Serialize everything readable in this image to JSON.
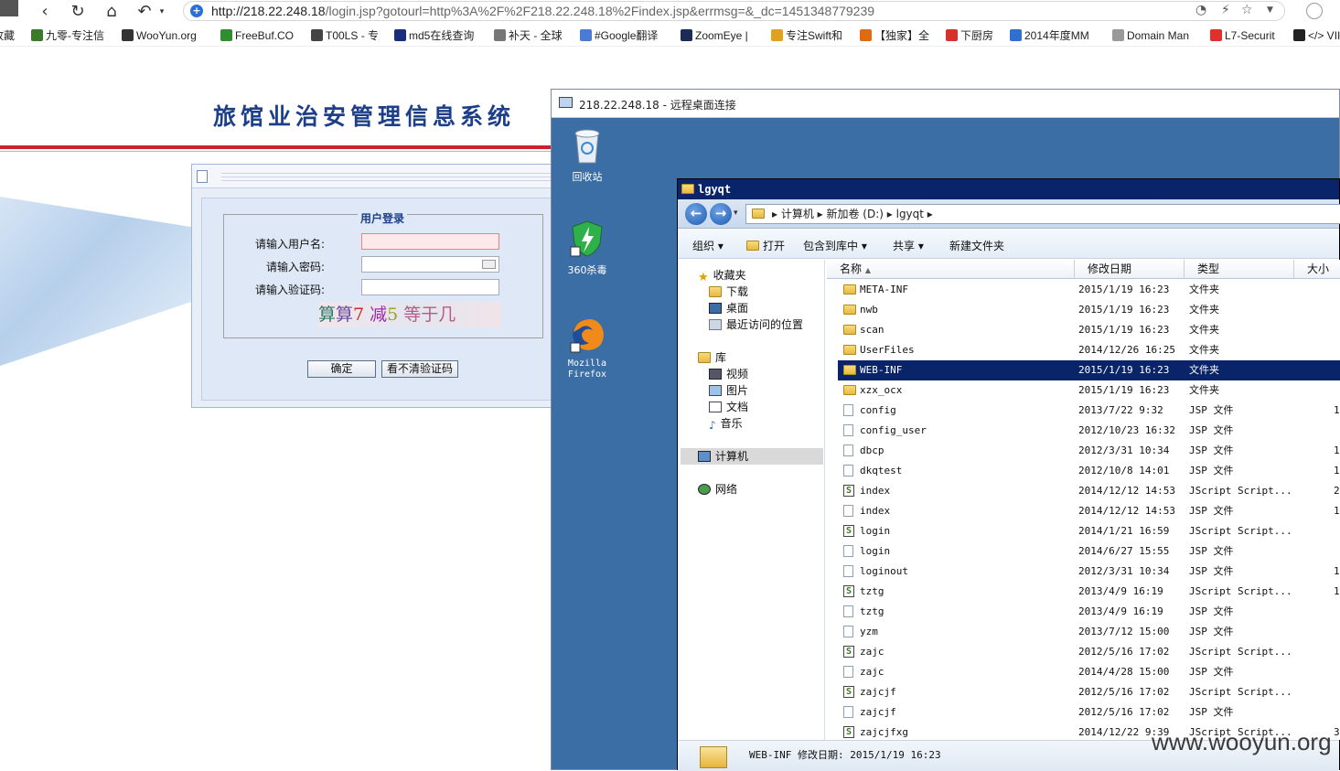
{
  "browser": {
    "url_host": "http://218.22.248.18",
    "url_path": "/login.jsp?gotourl=http%3A%2F%2F218.22.248.18%2Findex.jsp&errmsg=&_dc=1451348779239",
    "back_icon": "arrow-left-icon",
    "bookmarks": [
      {
        "label": "收藏",
        "color": "#888888"
      },
      {
        "label": "九零-专注信",
        "color": "#3c7a2a"
      },
      {
        "label": "WooYun.org",
        "color": "#333333"
      },
      {
        "label": "FreeBuf.CO",
        "color": "#2f8f2f"
      },
      {
        "label": "T00LS - 专",
        "color": "#444444"
      },
      {
        "label": "md5在线查询",
        "color": "#1a2d7a"
      },
      {
        "label": "补天 - 全球",
        "color": "#777777"
      },
      {
        "label": "#Google翻译",
        "color": "#4a7bd6"
      },
      {
        "label": "ZoomEye |",
        "color": "#1b2a57"
      },
      {
        "label": "专注Swift和",
        "color": "#e0a020"
      },
      {
        "label": "【独家】全",
        "color": "#e06a10"
      },
      {
        "label": "下厨房",
        "color": "#d6312b"
      },
      {
        "label": "2014年度MM",
        "color": "#2f6fd0"
      },
      {
        "label": "Domain Man",
        "color": "#999999"
      },
      {
        "label": "L7-Securit",
        "color": "#e0302a"
      },
      {
        "label": "</> VIIV P",
        "color": "#222222"
      }
    ]
  },
  "webpage": {
    "system_title": "旅馆业治安管理信息系统",
    "login": {
      "legend": "用户登录",
      "username_label": "请输入用户名:",
      "password_label": "请输入密码:",
      "captcha_label": "请输入验证码:",
      "captcha_parts": [
        "算",
        "算",
        "7",
        " 减",
        "5",
        " 等于几"
      ],
      "ok_button": "确定",
      "refresh_captcha_button": "看不清验证码"
    }
  },
  "rdp": {
    "title": "218.22.248.18 - 远程桌面连接",
    "desktop_icons": [
      {
        "label": "回收站",
        "icon": "recycle-bin-icon"
      },
      {
        "label": "360杀毒",
        "icon": "antivirus-shield-icon"
      },
      {
        "label": "Mozilla Firefox",
        "icon": "firefox-icon"
      }
    ],
    "explorer": {
      "title": "lgyqt",
      "breadcrumb": "▸ 计算机 ▸ 新加卷 (D:) ▸ lgyqt ▸",
      "toolbar": {
        "organize": "组织",
        "open": "打开",
        "include_in_library": "包含到库中",
        "share": "共享",
        "new_folder": "新建文件夹"
      },
      "nav": {
        "favorites": "收藏夹",
        "downloads": "下载",
        "desktop": "桌面",
        "recent": "最近访问的位置",
        "libraries": "库",
        "videos": "视频",
        "pictures": "图片",
        "documents": "文档",
        "music": "音乐",
        "computer": "计算机",
        "network": "网络"
      },
      "columns": {
        "name": "名称",
        "modified": "修改日期",
        "type": "类型",
        "size": "大小"
      },
      "files": [
        {
          "name": "META-INF",
          "date": "2015/1/19 16:23",
          "type": "文件夹",
          "size": "",
          "kind": "folder"
        },
        {
          "name": "nwb",
          "date": "2015/1/19 16:23",
          "type": "文件夹",
          "size": "",
          "kind": "folder"
        },
        {
          "name": "scan",
          "date": "2015/1/19 16:23",
          "type": "文件夹",
          "size": "",
          "kind": "folder"
        },
        {
          "name": "UserFiles",
          "date": "2014/12/26 16:25",
          "type": "文件夹",
          "size": "",
          "kind": "folder"
        },
        {
          "name": "WEB-INF",
          "date": "2015/1/19 16:23",
          "type": "文件夹",
          "size": "",
          "kind": "folder"
        },
        {
          "name": "xzx_ocx",
          "date": "2015/1/19 16:23",
          "type": "文件夹",
          "size": "",
          "kind": "folder"
        },
        {
          "name": "config",
          "date": "2013/7/22 9:32",
          "type": "JSP 文件",
          "size": "1",
          "kind": "file"
        },
        {
          "name": "config_user",
          "date": "2012/10/23 16:32",
          "type": "JSP 文件",
          "size": "",
          "kind": "file"
        },
        {
          "name": "dbcp",
          "date": "2012/3/31 10:34",
          "type": "JSP 文件",
          "size": "1",
          "kind": "file"
        },
        {
          "name": "dkqtest",
          "date": "2012/10/8 14:01",
          "type": "JSP 文件",
          "size": "1",
          "kind": "file"
        },
        {
          "name": "index",
          "date": "2014/12/12 14:53",
          "type": "JScript Script...",
          "size": "2",
          "kind": "script"
        },
        {
          "name": "index",
          "date": "2014/12/12 14:53",
          "type": "JSP 文件",
          "size": "1",
          "kind": "file"
        },
        {
          "name": "login",
          "date": "2014/1/21 16:59",
          "type": "JScript Script...",
          "size": "",
          "kind": "script"
        },
        {
          "name": "login",
          "date": "2014/6/27 15:55",
          "type": "JSP 文件",
          "size": "",
          "kind": "file"
        },
        {
          "name": "loginout",
          "date": "2012/3/31 10:34",
          "type": "JSP 文件",
          "size": "1",
          "kind": "file"
        },
        {
          "name": "tztg",
          "date": "2013/4/9 16:19",
          "type": "JScript Script...",
          "size": "1",
          "kind": "script"
        },
        {
          "name": "tztg",
          "date": "2013/4/9 16:19",
          "type": "JSP 文件",
          "size": "",
          "kind": "file"
        },
        {
          "name": "yzm",
          "date": "2013/7/12 15:00",
          "type": "JSP 文件",
          "size": "",
          "kind": "file"
        },
        {
          "name": "zajc",
          "date": "2012/5/16 17:02",
          "type": "JScript Script...",
          "size": "",
          "kind": "script"
        },
        {
          "name": "zajc",
          "date": "2014/4/28 15:00",
          "type": "JSP 文件",
          "size": "",
          "kind": "file"
        },
        {
          "name": "zajcjf",
          "date": "2012/5/16 17:02",
          "type": "JScript Script...",
          "size": "",
          "kind": "script"
        },
        {
          "name": "zajcjf",
          "date": "2012/5/16 17:02",
          "type": "JSP 文件",
          "size": "",
          "kind": "file"
        },
        {
          "name": "zajcjfxg",
          "date": "2014/12/22 9:39",
          "type": "JScript Script...",
          "size": "3",
          "kind": "script"
        }
      ],
      "selected_file": "WEB-INF",
      "status": "WEB-INF 修改日期: 2015/1/19 16:23"
    }
  },
  "watermark": "www.wooyun.org"
}
